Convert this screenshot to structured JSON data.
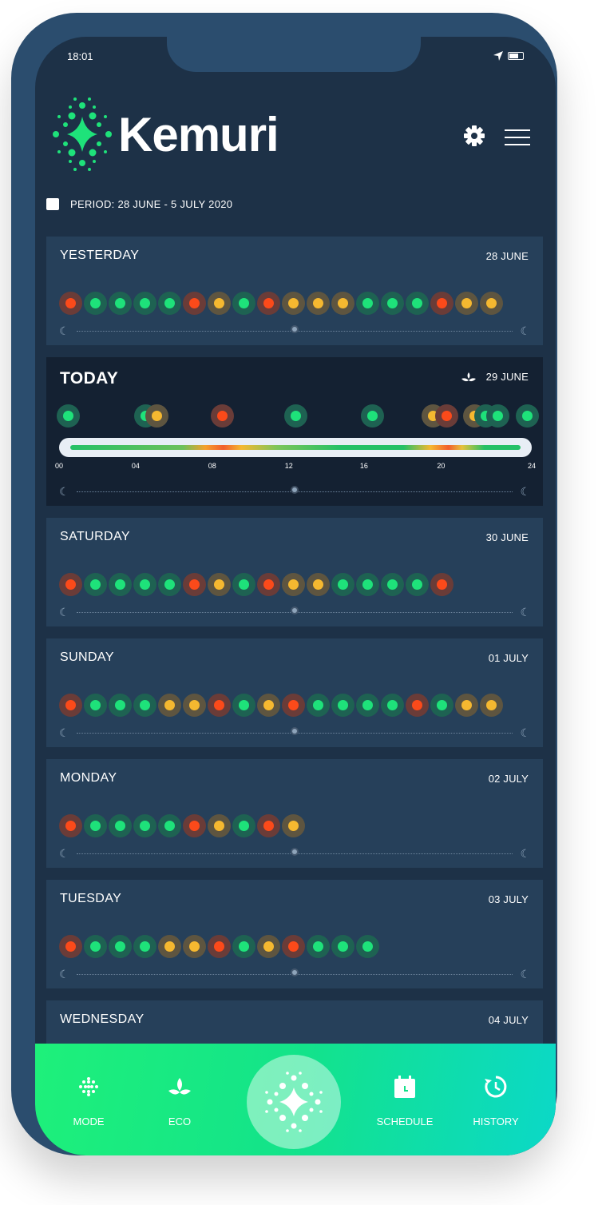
{
  "status": {
    "time": "18:01"
  },
  "brand": {
    "name": "Kemuri"
  },
  "period": {
    "label": "PERIOD: 28 JUNE - 5 JULY 2020"
  },
  "days": [
    {
      "title": "YESTERDAY",
      "date": "28 JUNE",
      "dots": [
        "r",
        "g",
        "g",
        "g",
        "g",
        "r",
        "y",
        "g",
        "r",
        "y",
        "y",
        "y",
        "g",
        "g",
        "g",
        "r",
        "y",
        "y"
      ]
    },
    {
      "title": "TODAY",
      "date": "29 JUNE",
      "today": true,
      "ticks": [
        "00",
        "04",
        "08",
        "12",
        "16",
        "20",
        "24"
      ]
    },
    {
      "title": "SATURDAY",
      "date": "30 JUNE",
      "dots": [
        "r",
        "g",
        "g",
        "g",
        "g",
        "r",
        "y",
        "g",
        "r",
        "y",
        "y",
        "g",
        "g",
        "g",
        "g",
        "r"
      ]
    },
    {
      "title": "SUNDAY",
      "date": "01 JULY",
      "dots": [
        "r",
        "g",
        "g",
        "g",
        "y",
        "y",
        "r",
        "g",
        "y",
        "r",
        "g",
        "g",
        "g",
        "g",
        "r",
        "g",
        "y",
        "y"
      ]
    },
    {
      "title": "MONDAY",
      "date": "02 JULY",
      "dots": [
        "r",
        "g",
        "g",
        "g",
        "g",
        "r",
        "y",
        "g",
        "r",
        "y"
      ]
    },
    {
      "title": "TUESDAY",
      "date": "03 JULY",
      "dots": [
        "r",
        "g",
        "g",
        "g",
        "y",
        "y",
        "r",
        "g",
        "y",
        "r",
        "g",
        "g",
        "g"
      ]
    },
    {
      "title": "WEDNESDAY",
      "date": "04 JULY",
      "dots": []
    }
  ],
  "nav": {
    "mode": "MODE",
    "eco": "ECO",
    "schedule": "SCHEDULE",
    "history": "HISTORY"
  },
  "colors": {
    "good": "#1ee27a",
    "bad": "#fb4a1a",
    "medium": "#f5b830",
    "nav_start": "#1ef07a",
    "nav_end": "#0bd8c8"
  }
}
